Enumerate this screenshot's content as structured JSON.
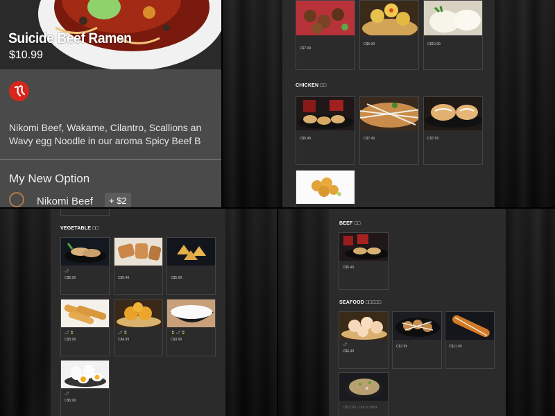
{
  "product": {
    "title": "Suicide Beef Ramen",
    "price": "$10.99",
    "description_line1": "Nikomi Beef, Wakame, Cilantro, Scallions an",
    "description_line2": "Wavy egg Noodle in our aroma Spicy Beef B",
    "spicy_icon": "chili-pepper-icon",
    "option_group": "My New Option",
    "option_name": "Nikomi Beef",
    "option_price": "+ $2"
  },
  "top_menu": {
    "top_row": [
      {
        "tag": "",
        "price": "C$7.99",
        "food": "fried-wings"
      },
      {
        "tag": "",
        "price": "C$5.99",
        "food": "siu-mai"
      },
      {
        "tag": "",
        "price": "C$10.99",
        "food": "steamed-buns"
      }
    ],
    "chicken_title": "CHICKEN □□",
    "chicken": [
      {
        "price": "C$5.49",
        "food": "chicken-gyoza"
      },
      {
        "price": "C$7.49",
        "food": "chicken-takoyaki"
      },
      {
        "price": "C$7.99",
        "food": "chicken-bao"
      },
      {
        "price": "",
        "food": "karaage"
      }
    ]
  },
  "vegetable_menu": {
    "title": "VEGETABLE □□",
    "items": [
      {
        "tag": "🌶",
        "price": "C$6.99",
        "food": "veg-gyoza"
      },
      {
        "tag": "",
        "price": "C$5.49",
        "food": "spring-rolls"
      },
      {
        "tag": "",
        "price": "C$5.99",
        "food": "wontons"
      },
      {
        "tag": "🌶 🍃",
        "price": "C$3.99",
        "food": "egg-rolls"
      },
      {
        "tag": "🌶 🍃",
        "price": "C$4.99",
        "food": "sesame-balls"
      },
      {
        "tag": "🍃 🌶 🍃",
        "price": "C$3.99",
        "food": "steamed-rice"
      },
      {
        "tag": "🌶",
        "price": "C$5.99",
        "food": "soft-eggs"
      }
    ]
  },
  "beef_menu": {
    "beef_title": "BEEF □□",
    "beef": [
      {
        "price": "C$5.49",
        "food": "beef-gyoza"
      }
    ],
    "seafood_title": "SEAFOOD □□□□□",
    "seafood": [
      {
        "tag": "🌶",
        "price": "C$6.49",
        "food": "har-gow"
      },
      {
        "tag": "",
        "price": "C$7.99",
        "food": "takoyaki"
      },
      {
        "tag": "",
        "price": "C$11.99",
        "food": "unagi"
      },
      {
        "tag": "",
        "price": "C$12.99 - Out of stock",
        "food": "okonomiyaki"
      }
    ]
  },
  "colors": {
    "panel": "#2b2b2b",
    "accent_red": "#d9261c",
    "radio_ring": "#b07a45"
  }
}
